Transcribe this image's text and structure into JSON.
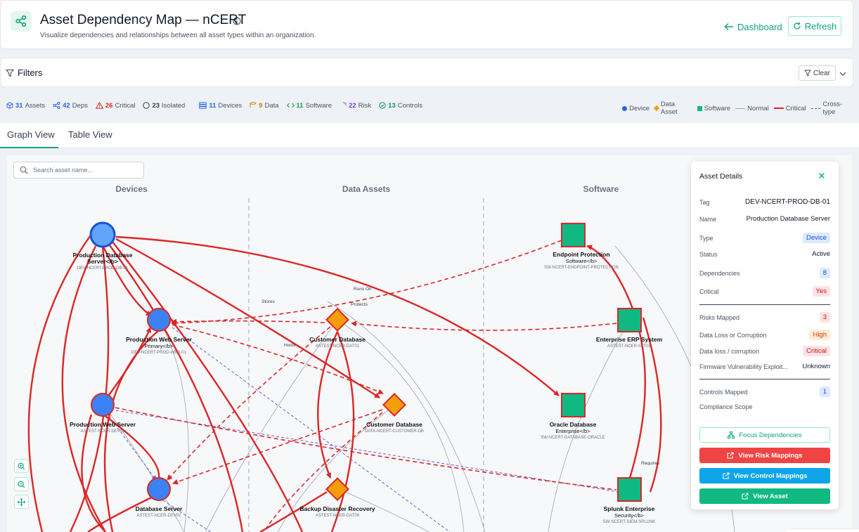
{
  "header": {
    "title": "Asset Dependency Map — nCERT",
    "subtitle": "Visualize dependencies and relationships between all asset types within an organization.",
    "dashboard_label": "Dashboard",
    "refresh_label": "Refresh",
    "icon": "share-nodes-icon"
  },
  "filters": {
    "label": "Filters",
    "clear_label": "Clear"
  },
  "stats": [
    {
      "icon": "cube-icon",
      "value": "31",
      "label": "Assets",
      "color": "#2563eb"
    },
    {
      "icon": "share-icon",
      "value": "42",
      "label": "Deps",
      "color": "#2563eb"
    },
    {
      "icon": "warning-icon",
      "value": "26",
      "label": "Critical",
      "color": "#dc2626"
    },
    {
      "icon": "circle-icon",
      "value": "23",
      "label": "Isolated",
      "color": "#374151"
    },
    {
      "icon": "server-icon",
      "value": "11",
      "label": "Devices",
      "color": "#2563eb"
    },
    {
      "icon": "database-icon",
      "value": "9",
      "label": "Data",
      "color": "#d97706"
    },
    {
      "icon": "code-icon",
      "value": "11",
      "label": "Software",
      "color": "#16a34a"
    },
    {
      "icon": "shield-icon",
      "value": "22",
      "label": "Risk",
      "color": "#7c3aed"
    },
    {
      "icon": "check-circle-icon",
      "value": "13",
      "label": "Controls",
      "color": "#059669"
    }
  ],
  "legend": [
    "Device",
    "Data Asset",
    "Software",
    "Normal",
    "Critical",
    "Cross-type"
  ],
  "colors": {
    "device": "#3b82f6",
    "data": "#f59e0b",
    "software": "#10b981",
    "critical": "#dc2626",
    "normal": "#9ca3af",
    "cross": "#6d5bd0",
    "accent": "#10a37f"
  },
  "tabs": [
    "Graph View",
    "Table View"
  ],
  "search_placeholder": "Search asset name...",
  "columns": [
    "Devices",
    "Data Assets",
    "Software"
  ],
  "nodes": [
    {
      "id": "d1",
      "name": "Production Database Server</b>",
      "sub": "",
      "tag": "DEV-NCERT-PROD-DB-01",
      "type": "device"
    },
    {
      "id": "d2",
      "name": "Production Web Server",
      "sub": "Primary</b>",
      "tag": "DEV-NCERT-PROD-WEB-01",
      "type": "device"
    },
    {
      "id": "d3",
      "name": "Production Web Server",
      "sub": "",
      "tag": "ASTEST-NCER-DEV01",
      "type": "device"
    },
    {
      "id": "d4",
      "name": "Database Server",
      "sub": "",
      "tag": "ASTEST-NCER-DEV02",
      "type": "device"
    },
    {
      "id": "a1",
      "name": "Customer Database",
      "sub": "",
      "tag": "ASTEST-NCER-DAT01",
      "type": "data"
    },
    {
      "id": "a2",
      "name": "Customer Database",
      "sub": "",
      "tag": "DATA-NCERT-CUSTOMER-DB",
      "type": "data"
    },
    {
      "id": "a3",
      "name": "Backup Disaster Recovery",
      "sub": "",
      "tag": "ASTEST-NCER-DAT09",
      "type": "data"
    },
    {
      "id": "s1",
      "name": "Endpoint Protection",
      "sub": "Software</b>",
      "tag": "SW-NCERT-ENDPOINT-PROTECTION",
      "type": "software"
    },
    {
      "id": "s2",
      "name": "Enterprise ERP System",
      "sub": "",
      "tag": "ASTEST-NCER-SFT01",
      "type": "software"
    },
    {
      "id": "s3",
      "name": "Oracle Database",
      "sub": "Enterprise</b>",
      "tag": "SW-NCERT-DATABASE-ORACLE",
      "type": "software"
    },
    {
      "id": "s4",
      "name": "Splunk Enterprise",
      "sub": "Security</b>",
      "tag": "SW-NCERT-SIEM-SPLUNK",
      "type": "software"
    }
  ],
  "edge_labels": [
    "Stores",
    "Runs On",
    "Protects",
    "Hosts",
    "Requires"
  ],
  "details": {
    "title": "Asset Details",
    "rows": [
      {
        "label": "Tag",
        "value": "DEV-NCERT-PROD-DB-01"
      },
      {
        "label": "Name",
        "value": "Production Database Server"
      },
      {
        "label": "Type",
        "value": "Device"
      },
      {
        "label": "Status",
        "value": "Active"
      },
      {
        "label": "Dependencies",
        "value": "8"
      },
      {
        "label": "Critical",
        "value": "Yes"
      },
      {
        "label": "Risks Mapped",
        "value": "3"
      },
      {
        "label": "Data Loss or Corruption",
        "value": "High"
      },
      {
        "label": "Data loss / corruption",
        "value": "Critical"
      },
      {
        "label": "Firmware Vulnerability Exploit...",
        "value": "Unknown"
      },
      {
        "label": "Controls Mapped",
        "value": "1"
      },
      {
        "label": "Compliance Scope",
        "value": ""
      }
    ],
    "actions": [
      "Focus Dependencies",
      "View Risk Mappings",
      "View Control Mappings",
      "View Asset"
    ]
  }
}
